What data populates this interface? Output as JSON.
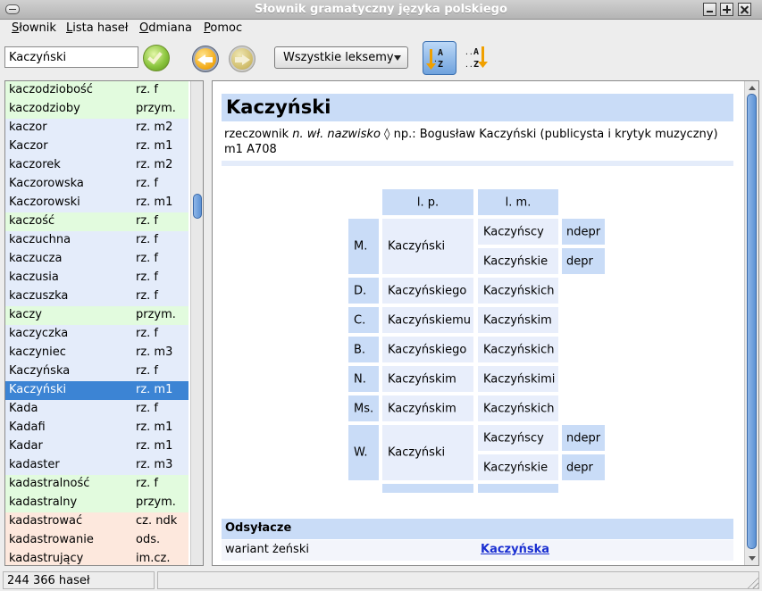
{
  "window": {
    "title": "Słownik gramatyczny języka polskiego"
  },
  "menu": [
    "Słownik",
    "Lista haseł",
    "Odmiana",
    "Pomoc"
  ],
  "toolbar": {
    "search_value": "Kaczyński",
    "filter_selected": "Wszystkie leksemy",
    "sort_az_label": "A..Z",
    "sort_za_label": "..A..Z"
  },
  "wordlist": [
    {
      "word": "kaczodziobość",
      "pos": "rz. f",
      "color": "green"
    },
    {
      "word": "kaczodzioby",
      "pos": "przym.",
      "color": "green"
    },
    {
      "word": "kaczor",
      "pos": "rz. m2",
      "color": "blue"
    },
    {
      "word": "Kaczor",
      "pos": "rz. m1",
      "color": "blue"
    },
    {
      "word": "kaczorek",
      "pos": "rz. m2",
      "color": "blue"
    },
    {
      "word": "Kaczorowska",
      "pos": "rz. f",
      "color": "blue"
    },
    {
      "word": "Kaczorowski",
      "pos": "rz. m1",
      "color": "blue"
    },
    {
      "word": "kaczość",
      "pos": "rz. f",
      "color": "green"
    },
    {
      "word": "kaczuchna",
      "pos": "rz. f",
      "color": "blue"
    },
    {
      "word": "kaczucza",
      "pos": "rz. f",
      "color": "blue"
    },
    {
      "word": "kaczusia",
      "pos": "rz. f",
      "color": "blue"
    },
    {
      "word": "kaczuszka",
      "pos": "rz. f",
      "color": "blue"
    },
    {
      "word": "kaczy",
      "pos": "przym.",
      "color": "green"
    },
    {
      "word": "kaczyczka",
      "pos": "rz. f",
      "color": "blue"
    },
    {
      "word": "kaczyniec",
      "pos": "rz. m3",
      "color": "blue"
    },
    {
      "word": "Kaczyńska",
      "pos": "rz. f",
      "color": "blue"
    },
    {
      "word": "Kaczyński",
      "pos": "rz. m1",
      "color": "selected"
    },
    {
      "word": "Kada",
      "pos": "rz. f",
      "color": "blue"
    },
    {
      "word": "Kadafi",
      "pos": "rz. m1",
      "color": "blue"
    },
    {
      "word": "Kadar",
      "pos": "rz. m1",
      "color": "blue"
    },
    {
      "word": "kadaster",
      "pos": "rz. m3",
      "color": "blue"
    },
    {
      "word": "kadastralność",
      "pos": "rz. f",
      "color": "green"
    },
    {
      "word": "kadastralny",
      "pos": "przym.",
      "color": "green"
    },
    {
      "word": "kadastrować",
      "pos": "cz. ndk",
      "color": "orange"
    },
    {
      "word": "kadastrowanie",
      "pos": "ods.",
      "color": "orange"
    },
    {
      "word": "kadastrujący",
      "pos": "im.cz.",
      "color": "orange"
    }
  ],
  "entry": {
    "headword": "Kaczyński",
    "desc_pre": "rzeczownik ",
    "desc_italic": "n. wł. nazwisko",
    "desc_post": " ◊ np.: Bogusław Kaczyński (publicysta i krytyk muzyczny)",
    "desc_line2": "m1 A708",
    "table": {
      "col_lp": "l. p.",
      "col_lm": "l. m.",
      "cases": [
        {
          "case": "M.",
          "sg": "Kaczyński",
          "pl": [
            "Kaczyńscy",
            "Kaczyńskie"
          ],
          "tags": [
            "ndepr",
            "depr"
          ]
        },
        {
          "case": "D.",
          "sg": "Kaczyńskiego",
          "pl": [
            "Kaczyńskich"
          ]
        },
        {
          "case": "C.",
          "sg": "Kaczyńskiemu",
          "pl": [
            "Kaczyńskim"
          ]
        },
        {
          "case": "B.",
          "sg": "Kaczyńskiego",
          "pl": [
            "Kaczyńskich"
          ]
        },
        {
          "case": "N.",
          "sg": "Kaczyńskim",
          "pl": [
            "Kaczyńskimi"
          ]
        },
        {
          "case": "Ms.",
          "sg": "Kaczyńskim",
          "pl": [
            "Kaczyńskich"
          ]
        },
        {
          "case": "W.",
          "sg": "Kaczyński",
          "pl": [
            "Kaczyńscy",
            "Kaczyńskie"
          ],
          "tags": [
            "ndepr",
            "depr"
          ]
        }
      ]
    },
    "references": {
      "title": "Odsyłacze",
      "label": "wariant żeński",
      "link": "Kaczyńska"
    }
  },
  "status": {
    "count": "244 366 haseł"
  },
  "colors": {
    "green": "#e2fbde",
    "blue": "#e4ecfa",
    "orange": "#fde8dd",
    "selected": "#3c84d4",
    "header": "#c9dcf7",
    "link": "#1a2fd1"
  }
}
